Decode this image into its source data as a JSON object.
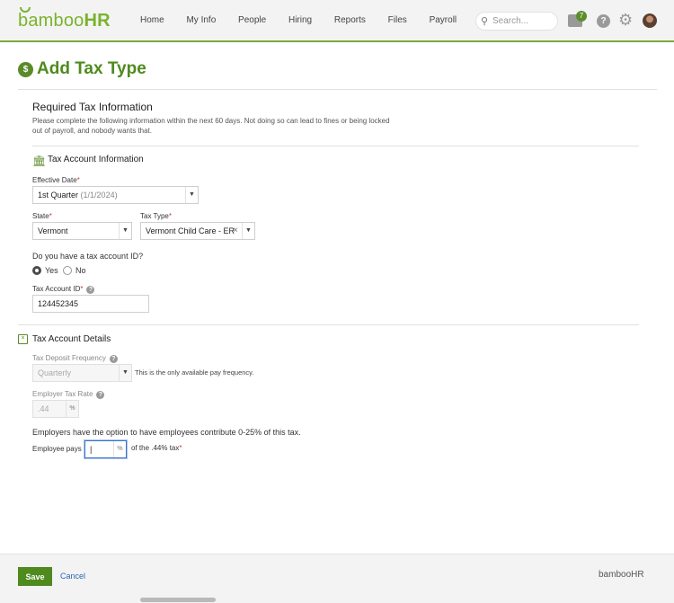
{
  "brand": {
    "logo_text": "bamboo",
    "logo_text_hr": "HR",
    "accent": "#7ab32c",
    "title_color": "#4f8a1e"
  },
  "nav": {
    "items": [
      "Home",
      "My Info",
      "People",
      "Hiring",
      "Reports",
      "Files",
      "Payroll"
    ],
    "search_placeholder": "Search...",
    "inbox_count": "7",
    "help_label": "?"
  },
  "page": {
    "title": "Add Tax Type",
    "title_icon": "$"
  },
  "required": {
    "heading": "Required Tax Information",
    "description": "Please complete the following information within the next 60 days. Not doing so can lead to fines or being locked out of payroll, and nobody wants that."
  },
  "tax_account_info": {
    "heading": "Tax Account Information",
    "effective_date_label": "Effective Date",
    "effective_date_value": "1st Quarter",
    "effective_date_hint": "(1/1/2024)",
    "state_label": "State",
    "state_value": "Vermont",
    "tax_type_label": "Tax Type",
    "tax_type_value": "Vermont Child Care - ER",
    "question": "Do you have a tax account ID?",
    "yes_label": "Yes",
    "no_label": "No",
    "has_account_id": "Yes",
    "account_id_label": "Tax Account ID",
    "account_id_value": "124452345"
  },
  "tax_account_details": {
    "heading": "Tax Account Details",
    "deposit_frequency_label": "Tax Deposit Frequency",
    "deposit_frequency_value": "Quarterly",
    "deposit_frequency_note": "This is the only available pay frequency.",
    "employer_rate_label": "Employer Tax Rate",
    "employer_rate_value": ".44",
    "percent_symbol": "%",
    "employee_option_text": "Employers have the option to have employees contribute 0-25% of this tax.",
    "employee_pays_label": "Employee pays",
    "employee_pays_value": "|",
    "employee_pays_suffix": "of the .44% tax"
  },
  "footer": {
    "save_label": "Save",
    "cancel_label": "Cancel",
    "logo_text": "bambooHR"
  },
  "required_marker": "*"
}
